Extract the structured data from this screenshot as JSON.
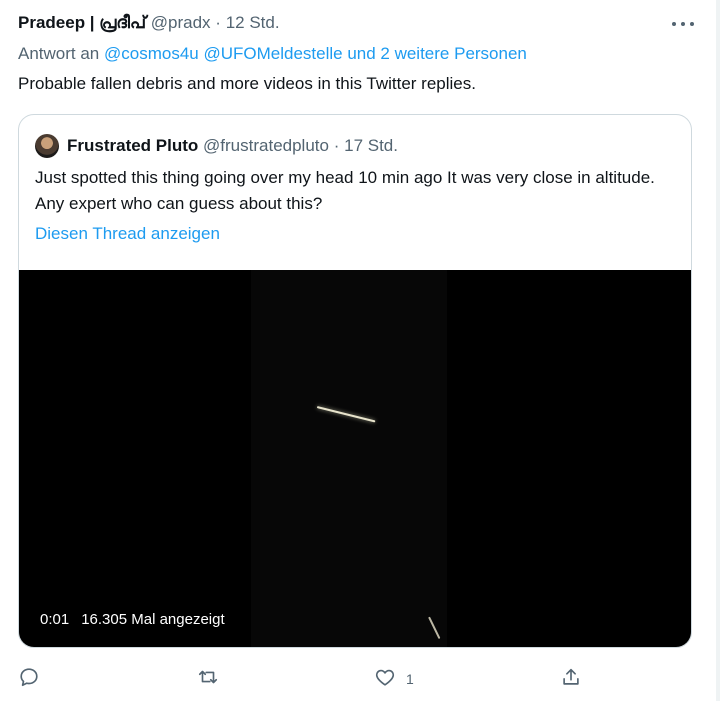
{
  "tweet": {
    "author_name": "Pradeep | പ്രദീപ്",
    "handle": "@pradx",
    "separator": "·",
    "time": "12 Std.",
    "reply_prefix": "Antwort an",
    "reply_handles": "@cosmos4u @UFOMeldestelle und 2 weitere Personen",
    "text": "Probable fallen debris and more videos in this Twitter replies."
  },
  "quote": {
    "author_name": "Frustrated Pluto",
    "handle": "@frustratedpluto",
    "separator": "·",
    "time": "17 Std.",
    "text": "Just spotted this thing going over my head 10 min ago It was very close in altitude. Any expert who can guess about this?",
    "thread_link": "Diesen Thread anzeigen"
  },
  "video": {
    "timestamp": "0:01",
    "views": "16.305 Mal angezeigt"
  },
  "actions": {
    "reply_icon": "reply-icon",
    "retweet_icon": "retweet-icon",
    "like_icon": "like-icon",
    "share_icon": "share-icon",
    "like_count": "1"
  },
  "colors": {
    "link": "#1d9bf0",
    "muted": "#536471",
    "text": "#0f1419",
    "border": "#cfd9de"
  }
}
